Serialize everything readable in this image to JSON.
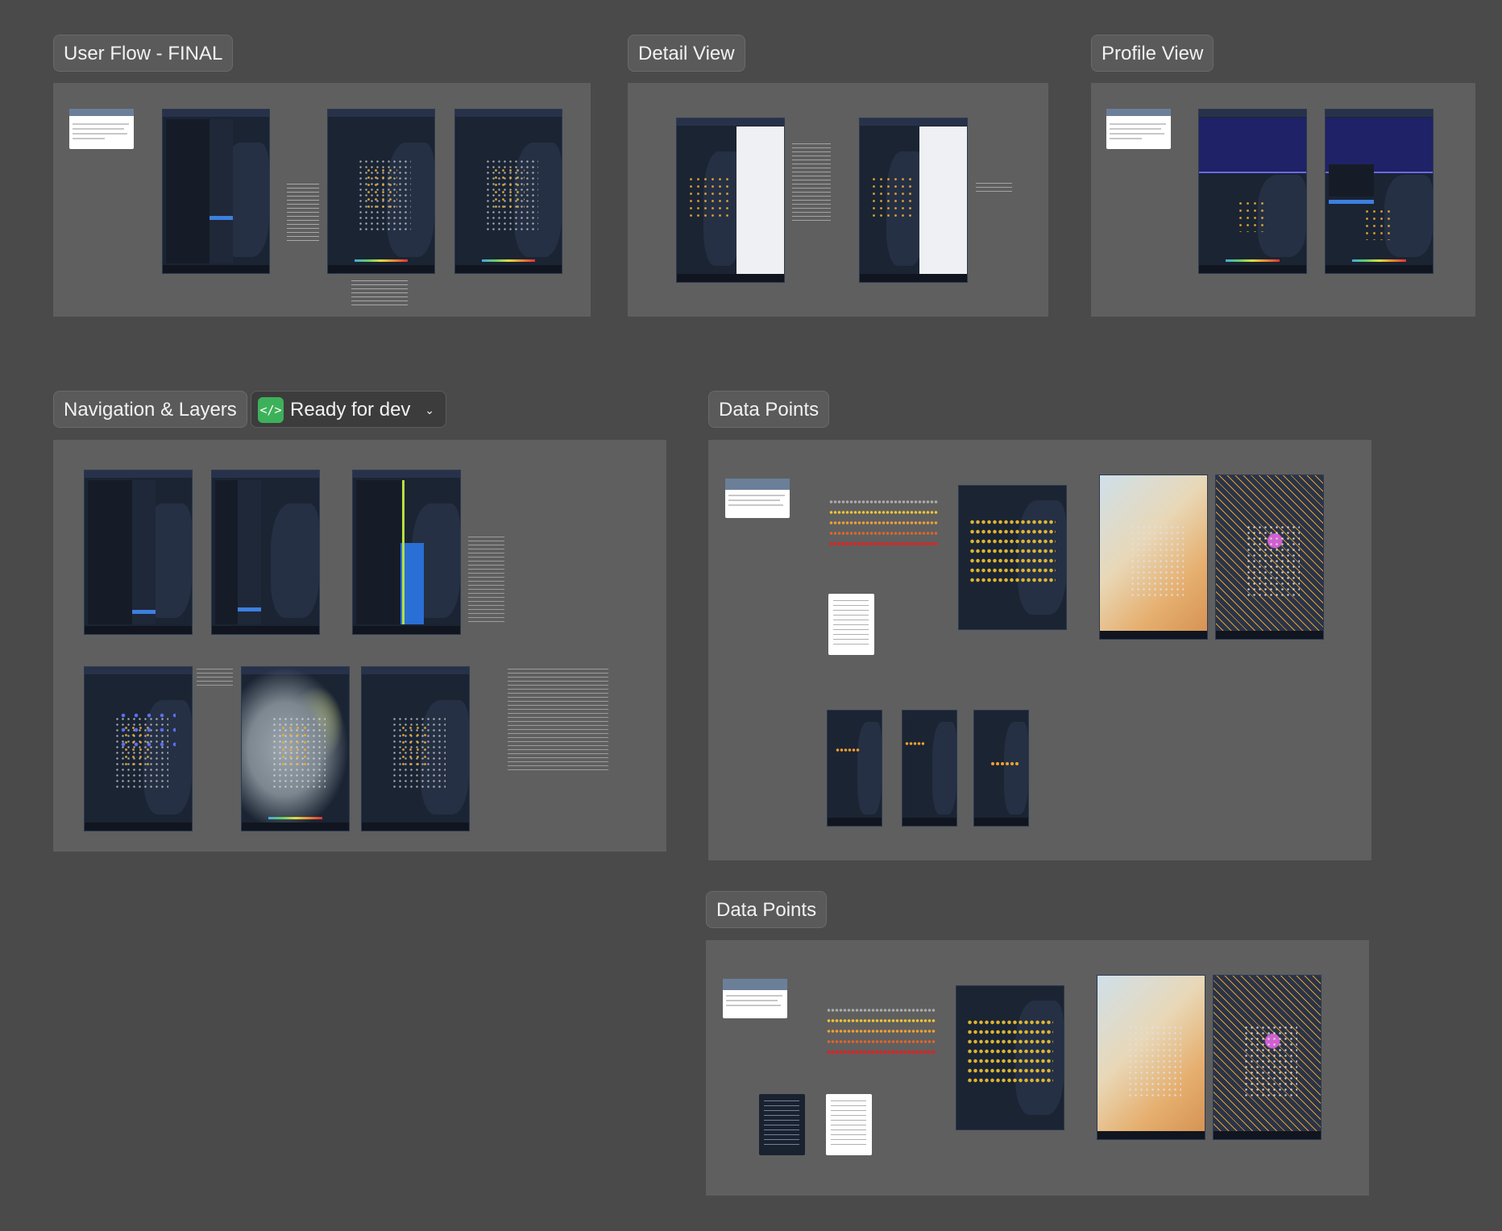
{
  "labels": {
    "user_flow": "User Flow - FINAL",
    "detail_view": "Detail View",
    "profile_view": "Profile View",
    "navigation_layers": "Navigation & Layers",
    "data_points_1": "Data Points",
    "data_points_2": "Data Points"
  },
  "status": {
    "icon": "</>",
    "label": "Ready for dev",
    "chevron": "⌄"
  },
  "icons": {
    "status_icon": "code-icon",
    "dropdown": "chevron-down-icon"
  },
  "colors": {
    "canvas": "#4a4a4a",
    "frame": "#5f5f5f",
    "ready_green": "#3db15a",
    "turbulence_levels": [
      "#dddddd",
      "#f2c531",
      "#f0a030",
      "#e0652a",
      "#cc2b2b"
    ]
  }
}
